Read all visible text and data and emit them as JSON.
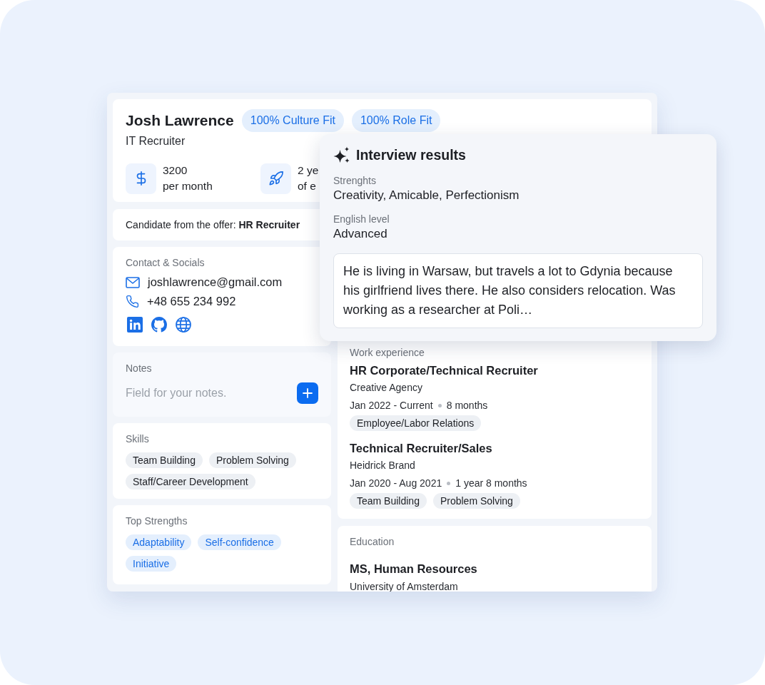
{
  "profile": {
    "name": "Josh Lawrence",
    "badges": [
      "100% Culture Fit",
      "100% Role Fit"
    ],
    "role": "IT Recruiter",
    "stats": [
      {
        "kind": "salary",
        "value": "3200",
        "caption": "per month"
      },
      {
        "kind": "experience",
        "value": "2 ye",
        "caption": "of e"
      }
    ]
  },
  "offer": {
    "text": "Candidate from the offer: **HR Recruiter**"
  },
  "contact": {
    "title": "Contact & Socials",
    "items": [
      {
        "kind": "email",
        "value": "joshlawrence@gmail.com"
      },
      {
        "kind": "phone",
        "value": "+48 655 234 992"
      }
    ]
  },
  "notes": {
    "title": "Notes",
    "placeholder": "Field for your notes."
  },
  "skills": {
    "title": "Skills",
    "tags": [
      "Team Building",
      "Problem Solving",
      "Staff/Career Development"
    ]
  },
  "top_strengths": {
    "title": "Top Strengths",
    "tags": [
      "Adaptability",
      "Self-confidence",
      "Initiative"
    ]
  },
  "work_experience": {
    "title": "Work experience",
    "jobs": [
      {
        "title": "HR Corporate/Technical Recruiter",
        "company": "Creative Agency",
        "period": "Jan 2022 - Current",
        "duration": "8 months",
        "tags": [
          "Employee/Labor Relations"
        ]
      },
      {
        "title": "Technical Recruiter/Sales",
        "company": "Heidrick Brand",
        "period": "Jan 2020 - Aug 2021",
        "duration": "1 year 8 months",
        "tags": [
          "Team Building",
          "Problem Solving"
        ]
      }
    ]
  },
  "education": {
    "title": "Education",
    "degree": "MS, Human Resources",
    "school": "University of Amsterdam"
  },
  "interview_results": {
    "title": "Interview results",
    "fields": [
      {
        "label": "Strenghts",
        "value": "Creativity, Amicable, Perfectionism"
      },
      {
        "label": "English level",
        "value": "Advanced"
      }
    ],
    "note": "He is living in Warsaw, but travels a lot to Gdynia because his girlfriend lives there. He also considers relocation. Was working as a researcher at Poli…"
  }
}
